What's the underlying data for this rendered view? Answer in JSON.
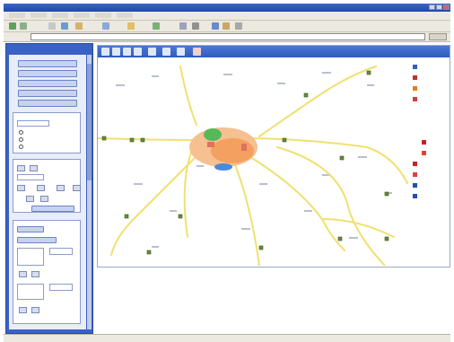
{
  "window": {
    "title": ""
  },
  "menu": {
    "items": [
      "",
      "",
      "",
      "",
      "",
      ""
    ]
  },
  "address": {
    "url": "",
    "go_label": ""
  },
  "left_panel": {
    "header": "",
    "buttons": [
      "",
      "",
      "",
      "",
      ""
    ],
    "search_group_title": "",
    "options": [
      "",
      "",
      ""
    ],
    "bottom_buttons": [
      "",
      ""
    ]
  },
  "map": {
    "toolbar_label": "",
    "place_labels": [
      "",
      ""
    ]
  },
  "legend": {
    "title": "",
    "items": [
      {
        "label": "",
        "color": "#3060c0"
      },
      {
        "label": "",
        "color": "#c03030"
      },
      {
        "label": "",
        "color": "#e08020"
      },
      {
        "label": "",
        "color": "#d04040"
      },
      {
        "label": "",
        "color": "#c02828"
      },
      {
        "label": "",
        "color": "#e04040"
      },
      {
        "label": "",
        "color": "#2050b0"
      },
      {
        "label": "",
        "color": "#2050b0"
      }
    ]
  },
  "status": {
    "text": ""
  },
  "colors": {
    "accent": "#2f5cbc",
    "road": "#f0e070",
    "urban": "#f4a060",
    "park": "#58b858"
  }
}
